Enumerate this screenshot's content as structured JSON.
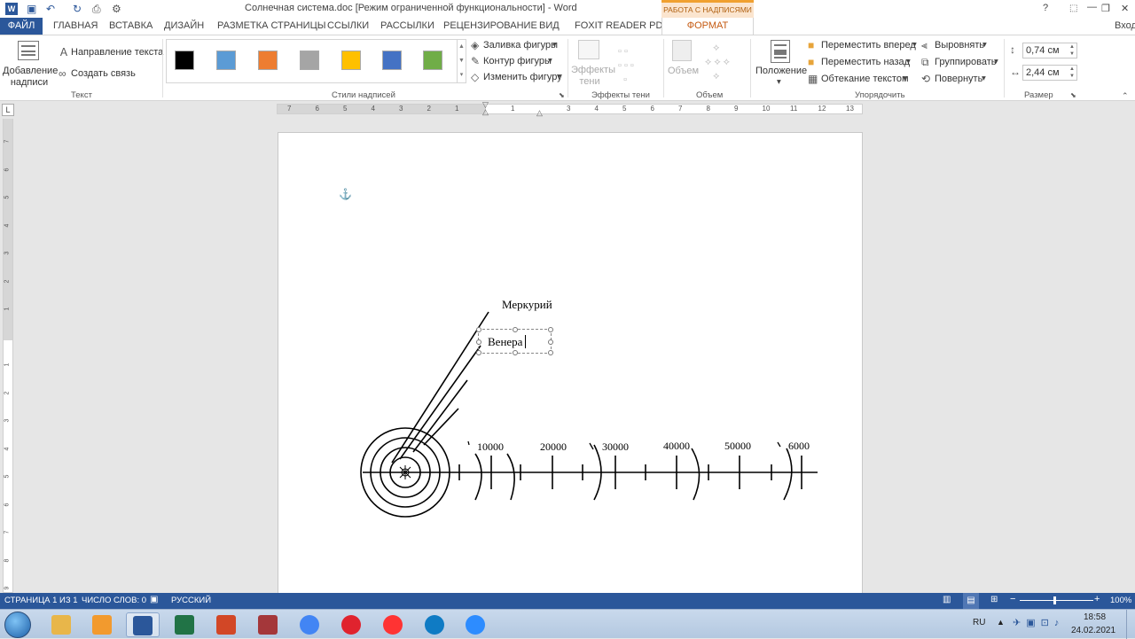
{
  "window": {
    "title": "Солнечная система.doc [Режим ограниченной функциональности] - Word",
    "help": "?",
    "minimize": "—",
    "restore": "❐",
    "close": "✕",
    "signin": "Вход"
  },
  "contextual": {
    "group_label": "РАБОТА С НАДПИСЯМИ",
    "format_tab": "ФОРМАТ"
  },
  "tabs": [
    "ФАЙЛ",
    "ГЛАВНАЯ",
    "ВСТАВКА",
    "ДИЗАЙН",
    "РАЗМЕТКА СТРАНИЦЫ",
    "ССЫЛКИ",
    "РАССЫЛКИ",
    "РЕЦЕНЗИРОВАНИЕ",
    "ВИД",
    "FOXIT READER PDF"
  ],
  "ribbon": {
    "text_group": {
      "add_textbox": "Добавление надписи",
      "text_direction": "Направление текста",
      "create_link": "Создать связь",
      "label": "Текст"
    },
    "styles_group": {
      "swatches": [
        "#000000",
        "#5b9bd5",
        "#ed7d31",
        "#a5a5a5",
        "#ffc000",
        "#4472c4",
        "#70ad47"
      ],
      "fill": "Заливка фигуры",
      "outline": "Контур фигуры",
      "change": "Изменить фигуру",
      "label": "Стили надписей"
    },
    "shadow_group": {
      "effects": "Эффекты тени",
      "label": "Эффекты тени"
    },
    "volume_group": {
      "volume": "Объем",
      "label": "Объем"
    },
    "arrange_group": {
      "position": "Положение",
      "bring_forward": "Переместить вперед",
      "send_backward": "Переместить назад",
      "wrap": "Обтекание текстом",
      "align": "Выровнять",
      "group": "Группировать",
      "rotate": "Повернуть",
      "label": "Упорядочить"
    },
    "size_group": {
      "height": "0,74 см",
      "width": "2,44 см",
      "label": "Размер"
    }
  },
  "ruler": {
    "marks": [
      "7",
      "6",
      "5",
      "4",
      "3",
      "2",
      "1",
      "",
      "1",
      "",
      "3",
      "4",
      "5",
      "6",
      "7",
      "8",
      "9",
      "10",
      "11",
      "12",
      "13"
    ],
    "left_marks": [
      "7",
      "6",
      "5",
      "4",
      "3",
      "2",
      "1",
      "",
      "1",
      "2",
      "3",
      "4",
      "5",
      "6",
      "7",
      "8",
      "9"
    ]
  },
  "document": {
    "label_mercury": "Меркурий",
    "label_venus": "Венера",
    "scale_labels": [
      "10000",
      "20000",
      "30000",
      "40000",
      "50000",
      "6000"
    ]
  },
  "status": {
    "page": "СТРАНИЦА 1 ИЗ 1",
    "words": "ЧИСЛО СЛОВ: 0",
    "language": "РУССКИЙ",
    "zoom": "100%"
  },
  "taskbar": {
    "lang": "RU",
    "time": "18:58",
    "date": "24.02.2021",
    "apps": [
      {
        "name": "explorer",
        "color": "#e8b64a"
      },
      {
        "name": "media-player",
        "color": "#f29a2e"
      },
      {
        "name": "word",
        "color": "#2b579a"
      },
      {
        "name": "excel",
        "color": "#217346"
      },
      {
        "name": "powerpoint",
        "color": "#d24726"
      },
      {
        "name": "access",
        "color": "#a4373a"
      },
      {
        "name": "chrome",
        "color": "#4285f4"
      },
      {
        "name": "opera",
        "color": "#e0232e"
      },
      {
        "name": "yandex",
        "color": "#ff3333"
      },
      {
        "name": "edge",
        "color": "#0f7bc4"
      },
      {
        "name": "zoom",
        "color": "#2d8cff"
      }
    ]
  }
}
